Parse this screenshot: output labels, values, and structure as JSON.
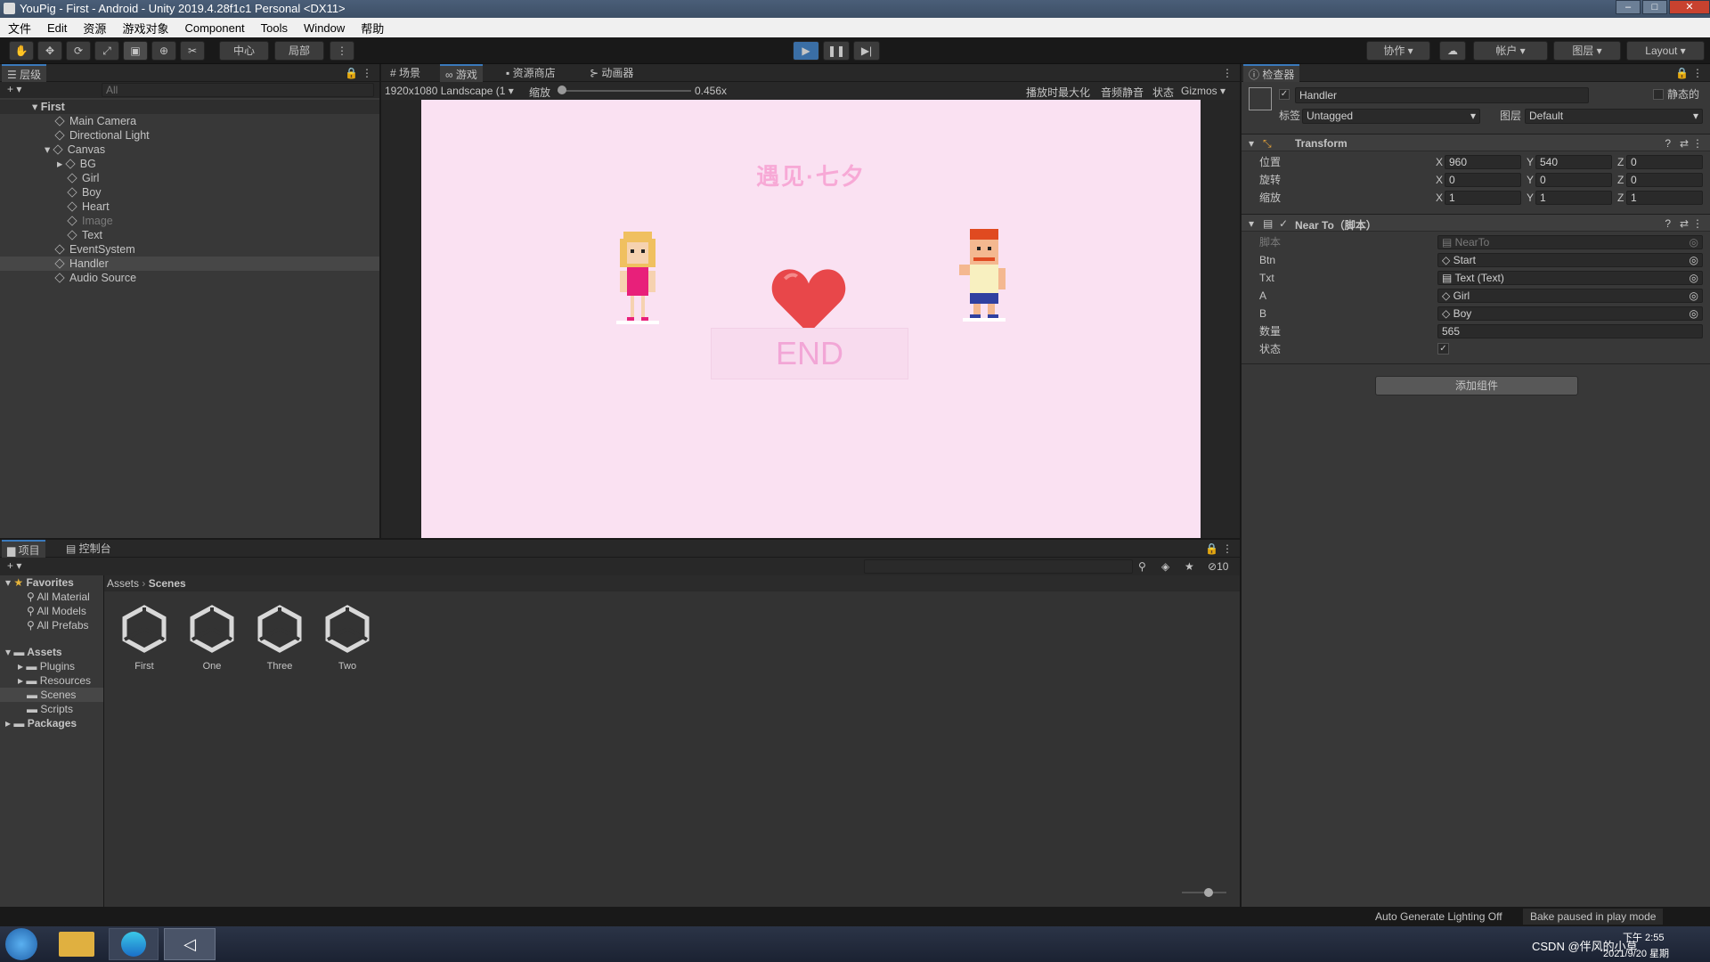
{
  "window": {
    "title": "YouPig - First - Android - Unity 2019.4.28f1c1 Personal <DX11>"
  },
  "menu": [
    "文件",
    "Edit",
    "资源",
    "游戏对象",
    "Component",
    "Tools",
    "Window",
    "帮助"
  ],
  "toolbar": {
    "pivot": "中心",
    "local": "局部",
    "collab": "协作",
    "account": "帐户",
    "layers": "图层",
    "layout": "Layout"
  },
  "hierarchy": {
    "tab": "层级",
    "search_placeholder": "All",
    "scene": "First",
    "items": [
      "Main Camera",
      "Directional Light",
      "Canvas",
      "BG",
      "Girl",
      "Boy",
      "Heart",
      "Image",
      "Text",
      "EventSystem",
      "Handler",
      "Audio Source"
    ]
  },
  "game_view": {
    "tabs": [
      "场景",
      "游戏",
      "资源商店",
      "动画器"
    ],
    "resolution": "1920x1080 Landscape (1",
    "scale_label": "缩放",
    "scale_value": "0.456x",
    "options": [
      "播放时最大化",
      "音频静音",
      "状态",
      "Gizmos"
    ],
    "game_title": "遇见·七夕",
    "end_text": "END",
    "bg_color": "#fae1f2"
  },
  "inspector": {
    "tab": "检查器",
    "object_name": "Handler",
    "static_label": "静态的",
    "tag_label": "标签",
    "tag_value": "Untagged",
    "layer_label": "图层",
    "layer_value": "Default",
    "transform": {
      "title": "Transform",
      "position_label": "位置",
      "rotation_label": "旋转",
      "scale_label": "缩放",
      "position": [
        "960",
        "540",
        "0"
      ],
      "rotation": [
        "0",
        "0",
        "0"
      ],
      "scale": [
        "1",
        "1",
        "1"
      ]
    },
    "script": {
      "title": "Near To（脚本）",
      "script_label": "脚本",
      "script_value": "NearTo",
      "btn_label": "Btn",
      "btn_value": "Start",
      "txt_label": "Txt",
      "txt_value": "Text (Text)",
      "a_label": "A",
      "a_value": "Girl",
      "b_label": "B",
      "b_value": "Boy",
      "count_label": "数量",
      "count_value": "565",
      "state_label": "状态",
      "state_value": "✓"
    },
    "add_component": "添加组件"
  },
  "project": {
    "tabs": [
      "项目",
      "控制台"
    ],
    "favorites": "Favorites",
    "fav_items": [
      "All Material",
      "All Models",
      "All Prefabs"
    ],
    "assets": "Assets",
    "asset_folders": [
      "Plugins",
      "Resources",
      "Scenes",
      "Scripts"
    ],
    "packages": "Packages",
    "breadcrumb": [
      "Assets",
      "Scenes"
    ],
    "scenes": [
      "First",
      "One",
      "Three",
      "Two"
    ],
    "hidden_count": "10"
  },
  "status": {
    "lighting": "Auto Generate Lighting Off",
    "bake": "Bake paused in play mode"
  },
  "taskbar": {
    "tray": "CSDN @伴风的小草",
    "time": "下午 2:55",
    "date": "2021/9/20 星期"
  }
}
